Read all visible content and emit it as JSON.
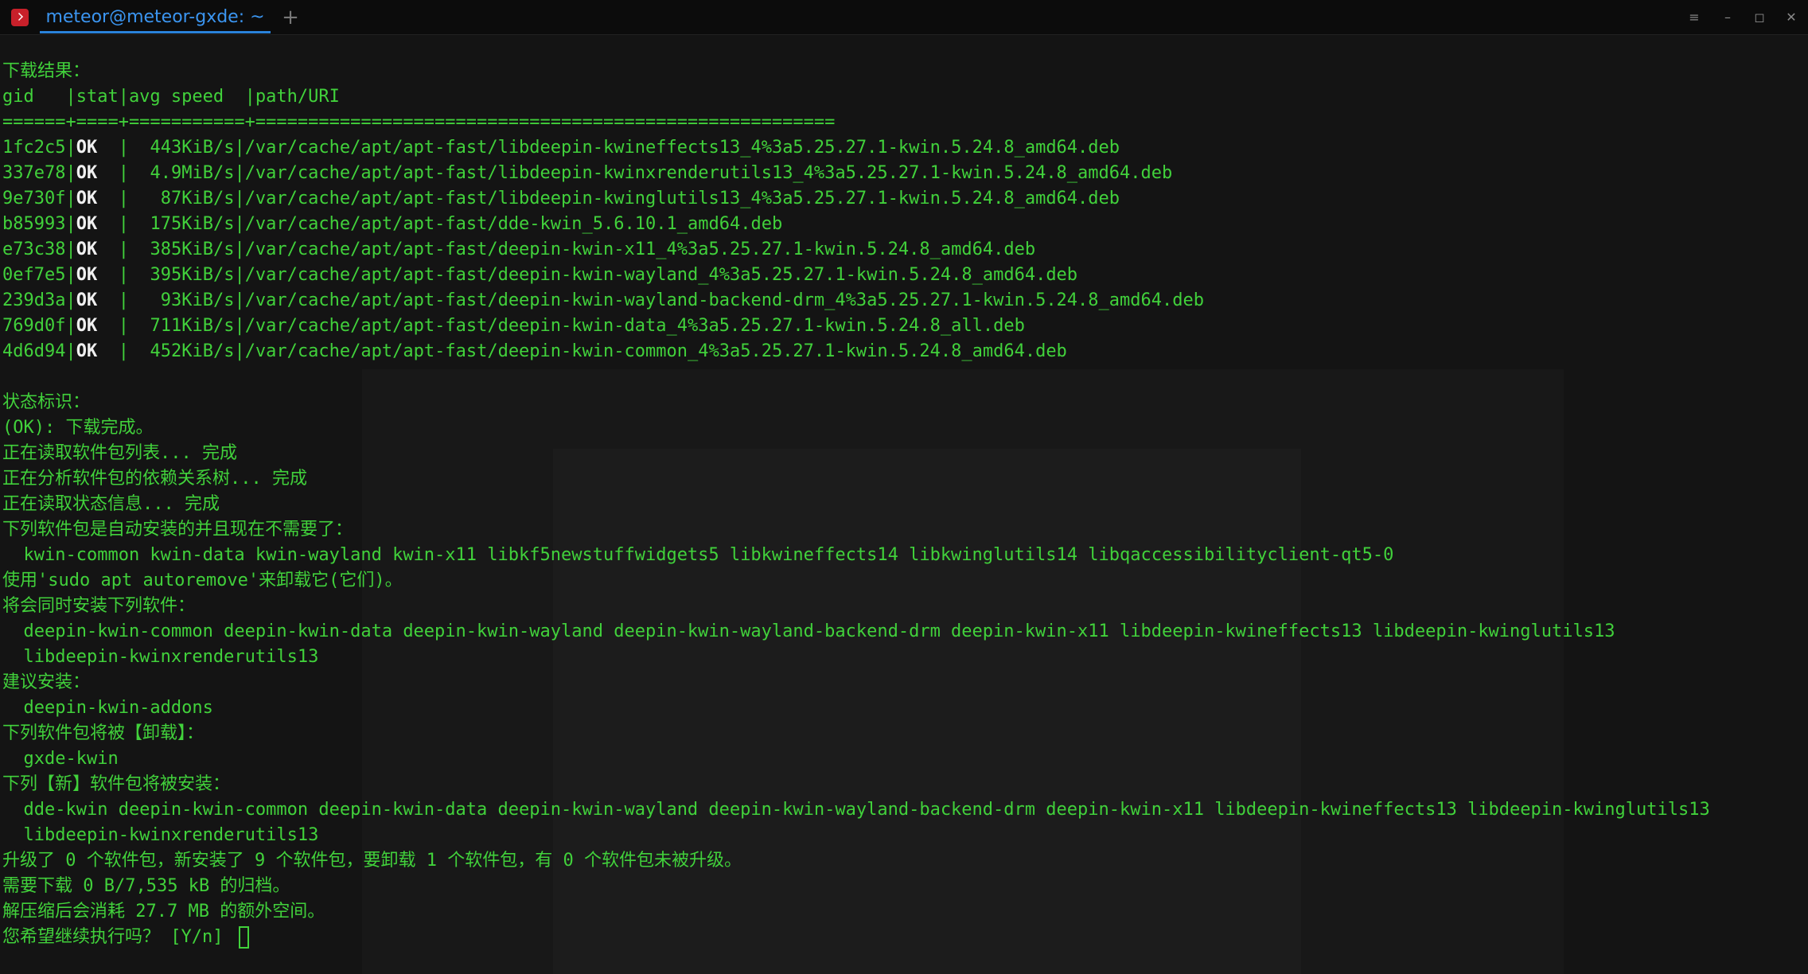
{
  "window": {
    "tab_title": "meteor@meteor-gxde: ~",
    "tab_add": "+",
    "menu_glyph": "≡",
    "minimize_glyph": "–",
    "maximize_glyph": "◻",
    "close_glyph": "✕"
  },
  "terminal": {
    "download_header": "下载结果：",
    "table_header": "gid   |stat|avg speed  |path/URI",
    "table_sep": "======+====+===========+=======================================================",
    "downloads": [
      {
        "gid": "1fc2c5",
        "stat": "OK",
        "speed": "  443KiB/s",
        "path": "/var/cache/apt/apt-fast/libdeepin-kwineffects13_4%3a5.25.27.1-kwin.5.24.8_amd64.deb"
      },
      {
        "gid": "337e78",
        "stat": "OK",
        "speed": "  4.9MiB/s",
        "path": "/var/cache/apt/apt-fast/libdeepin-kwinxrenderutils13_4%3a5.25.27.1-kwin.5.24.8_amd64.deb"
      },
      {
        "gid": "9e730f",
        "stat": "OK",
        "speed": "   87KiB/s",
        "path": "/var/cache/apt/apt-fast/libdeepin-kwinglutils13_4%3a5.25.27.1-kwin.5.24.8_amd64.deb"
      },
      {
        "gid": "b85993",
        "stat": "OK",
        "speed": "  175KiB/s",
        "path": "/var/cache/apt/apt-fast/dde-kwin_5.6.10.1_amd64.deb"
      },
      {
        "gid": "e73c38",
        "stat": "OK",
        "speed": "  385KiB/s",
        "path": "/var/cache/apt/apt-fast/deepin-kwin-x11_4%3a5.25.27.1-kwin.5.24.8_amd64.deb"
      },
      {
        "gid": "0ef7e5",
        "stat": "OK",
        "speed": "  395KiB/s",
        "path": "/var/cache/apt/apt-fast/deepin-kwin-wayland_4%3a5.25.27.1-kwin.5.24.8_amd64.deb"
      },
      {
        "gid": "239d3a",
        "stat": "OK",
        "speed": "   93KiB/s",
        "path": "/var/cache/apt/apt-fast/deepin-kwin-wayland-backend-drm_4%3a5.25.27.1-kwin.5.24.8_amd64.deb"
      },
      {
        "gid": "769d0f",
        "stat": "OK",
        "speed": "  711KiB/s",
        "path": "/var/cache/apt/apt-fast/deepin-kwin-data_4%3a5.25.27.1-kwin.5.24.8_all.deb"
      },
      {
        "gid": "4d6d94",
        "stat": "OK",
        "speed": "  452KiB/s",
        "path": "/var/cache/apt/apt-fast/deepin-kwin-common_4%3a5.25.27.1-kwin.5.24.8_amd64.deb"
      }
    ],
    "status_header": "状态标识：",
    "status_ok": "(OK): 下载完成。",
    "reading_list": "正在读取软件包列表... 完成",
    "analyzing_deps": "正在分析软件包的依赖关系树... 完成",
    "reading_state": "正在读取状态信息... 完成",
    "auto_installed_header": "下列软件包是自动安装的并且现在不需要了：",
    "auto_installed_list": "  kwin-common kwin-data kwin-wayland kwin-x11 libkf5newstuffwidgets5 libkwineffects14 libkwinglutils14 libqaccessibilityclient-qt5-0",
    "autoremove_hint": "使用'sudo apt autoremove'来卸载它(它们)。",
    "extra_header": "将会同时安装下列软件：",
    "extra_list_1": "  deepin-kwin-common deepin-kwin-data deepin-kwin-wayland deepin-kwin-wayland-backend-drm deepin-kwin-x11 libdeepin-kwineffects13 libdeepin-kwinglutils13",
    "extra_list_2": "  libdeepin-kwinxrenderutils13",
    "suggested_header": "建议安装：",
    "suggested_list": "  deepin-kwin-addons",
    "remove_header": "下列软件包将被【卸载】：",
    "remove_list": "  gxde-kwin",
    "new_header": "下列【新】软件包将被安装：",
    "new_list_1": "  dde-kwin deepin-kwin-common deepin-kwin-data deepin-kwin-wayland deepin-kwin-wayland-backend-drm deepin-kwin-x11 libdeepin-kwineffects13 libdeepin-kwinglutils13",
    "new_list_2": "  libdeepin-kwinxrenderutils13",
    "summary": "升级了 0 个软件包，新安装了 9 个软件包，要卸载 1 个软件包，有 0 个软件包未被升级。",
    "download_size": "需要下载 0 B/7,535 kB 的归档。",
    "disk_space": "解压缩后会消耗 27.7 MB 的额外空间。",
    "prompt": "您希望继续执行吗？ [Y/n] "
  },
  "colors": {
    "text_green": "#41d13b",
    "ok_white": "#f0f0f0",
    "tab_blue": "#3b95f0",
    "background": "#141414"
  }
}
